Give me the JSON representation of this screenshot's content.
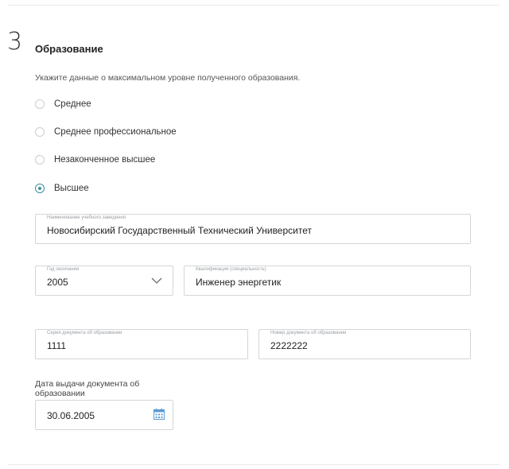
{
  "section": {
    "number": "3",
    "title": "Образование",
    "instruction": "Укажите данные о максимальном уровне полученного образования."
  },
  "education_options": [
    {
      "label": "Среднее",
      "selected": false
    },
    {
      "label": "Среднее профессиональное",
      "selected": false
    },
    {
      "label": "Незаконченное высшее",
      "selected": false
    },
    {
      "label": "Высшее",
      "selected": true
    }
  ],
  "fields": {
    "institution": {
      "label": "Наименование учебного заведения",
      "value": "Новосибирский Государственный Технический Университет"
    },
    "graduation_year": {
      "label": "Год окончания",
      "value": "2005"
    },
    "qualification": {
      "label": "Квалификация (специальность)",
      "value": "Инженер энергетик"
    },
    "doc_series": {
      "label": "Серия документа об образовании",
      "value": "1111"
    },
    "doc_number": {
      "label": "Номер документа об образовании",
      "value": "2222222"
    },
    "issue_date": {
      "label": "Дата выдачи документа об образовании",
      "value": "30.06.2005"
    }
  },
  "colors": {
    "accent": "#3b8f9a",
    "border": "#d3d6d9",
    "calendar_icon": "#5b9bd5"
  },
  "icons": {
    "year_dropdown": "chevron-down-icon",
    "date_picker": "calendar-icon"
  }
}
